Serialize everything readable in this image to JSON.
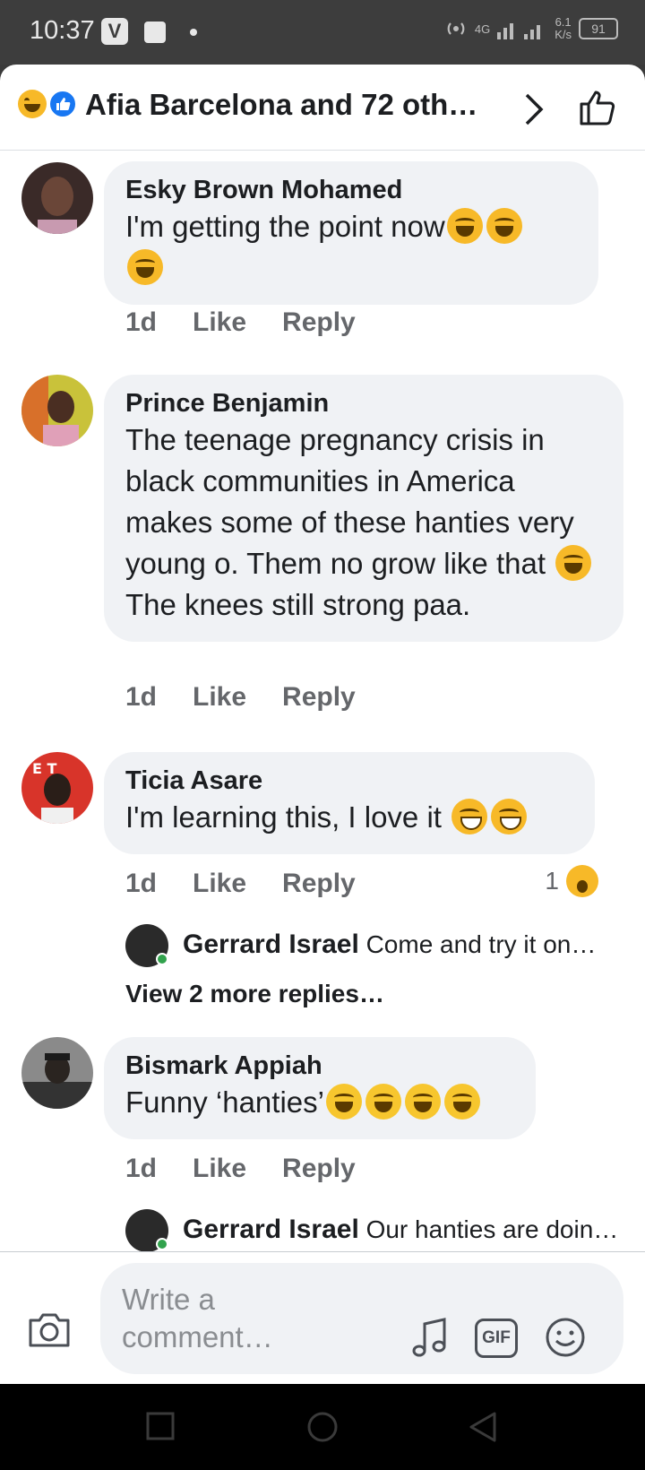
{
  "status_bar": {
    "time": "10:37",
    "app_icon_letter": "V",
    "network": "4G",
    "speed_value": "6.1",
    "speed_unit": "K/s",
    "battery": "91"
  },
  "header": {
    "title": "Afia Barcelona and 72 oth…",
    "reaction_icons": [
      "laugh-icon",
      "like-icon"
    ]
  },
  "comments": [
    {
      "author": "Esky Brown Mohamed",
      "text": "I'm getting the point now",
      "emoji": [
        "rolling-laugh",
        "rolling-laugh",
        "rolling-laugh"
      ],
      "time": "1d",
      "like_label": "Like",
      "reply_label": "Reply"
    },
    {
      "author": "Prince Benjamin",
      "text": "The teenage pregnancy crisis in black communities in America makes some of these hanties very young o. Them no grow like that",
      "text_after_emoji": "The knees still strong paa.",
      "emoji": [
        "tears-of-joy"
      ],
      "time": "1d",
      "like_label": "Like",
      "reply_label": "Reply"
    },
    {
      "author": "Ticia Asare",
      "text": "I'm learning this, I love it",
      "emoji": [
        "grin",
        "grin"
      ],
      "time": "1d",
      "like_label": "Like",
      "reply_label": "Reply",
      "reaction_count": "1",
      "reply_preview": {
        "author": "Gerrard Israel",
        "text": "Come and try it on…"
      },
      "more_replies": "View 2 more replies…"
    },
    {
      "author": "Bismark Appiah",
      "text": "Funny ‘hanties’",
      "emoji": [
        "sweat-smile",
        "sweat-smile",
        "sweat-smile",
        "sweat-smile"
      ],
      "time": "1d",
      "like_label": "Like",
      "reply_label": "Reply",
      "reply_preview": {
        "author": "Gerrard Israel",
        "text": "Our hanties are doin…"
      }
    }
  ],
  "composer": {
    "placeholder": "Write a comment…",
    "gif_label": "GIF"
  },
  "colors": {
    "bubble": "#f0f2f5",
    "meta_text": "#65676b",
    "like_blue": "#1877f2",
    "emoji_yellow": "#f7b928"
  }
}
